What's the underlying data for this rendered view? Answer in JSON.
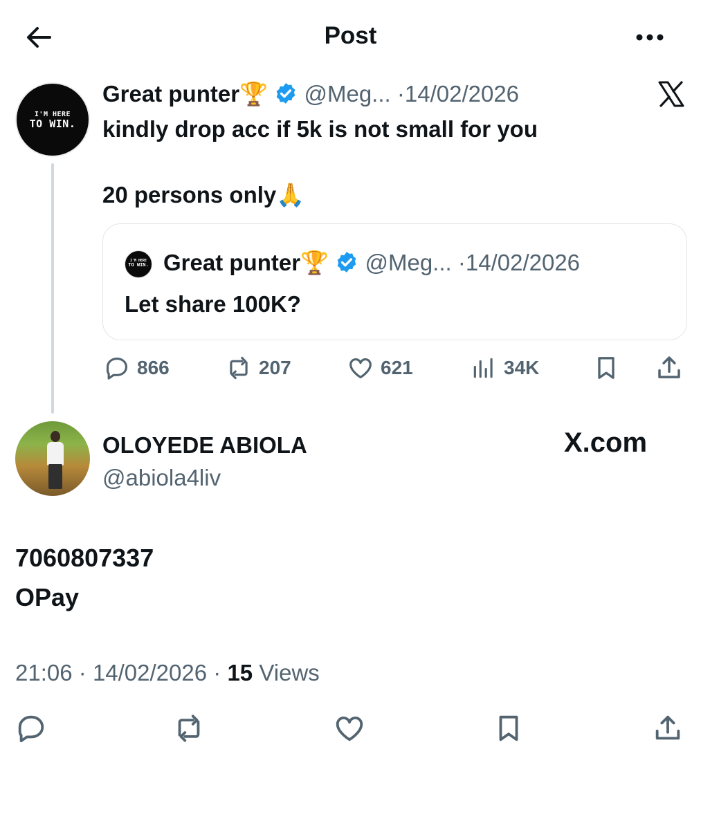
{
  "header": {
    "title": "Post",
    "back_icon": "arrow-left-icon",
    "more_icon": "more-horizontal-icon"
  },
  "original_post": {
    "display_name": "Great punter",
    "name_emoji": "🏆",
    "handle": "@Meg...",
    "separator": "·",
    "date": "14/02/2026",
    "text_line_1": "kindly drop acc if 5k is not small for you",
    "text_line_2": "20 persons only",
    "text_emoji": "🙏",
    "avatar_text_line_1": "I'M HERE",
    "avatar_text_line_2": "TO WIN.",
    "quote": {
      "display_name": "Great punter",
      "name_emoji": "🏆",
      "handle": "@Meg...",
      "separator": "·",
      "date": "14/02/2026",
      "text": "Let share 100K?",
      "avatar_text_line_1": "I'M HERE",
      "avatar_text_line_2": "TO WIN."
    },
    "actions": {
      "replies": "866",
      "reposts": "207",
      "likes": "621",
      "views": "34K"
    }
  },
  "reply": {
    "display_name": "OLOYEDE ABIOLA",
    "handle": "@abiola4liv",
    "watermark": "X.com",
    "text_line_1": "7060807337",
    "text_line_2": "OPay",
    "time": "21:06",
    "separator": "·",
    "date": "14/02/2026",
    "separator_2": "·",
    "views_count": "15",
    "views_label": "Views"
  },
  "colors": {
    "text": "#0f1419",
    "muted": "#536471",
    "verified": "#1d9bf0",
    "border": "#e1e6ea",
    "thread_line": "#cfd9de"
  }
}
